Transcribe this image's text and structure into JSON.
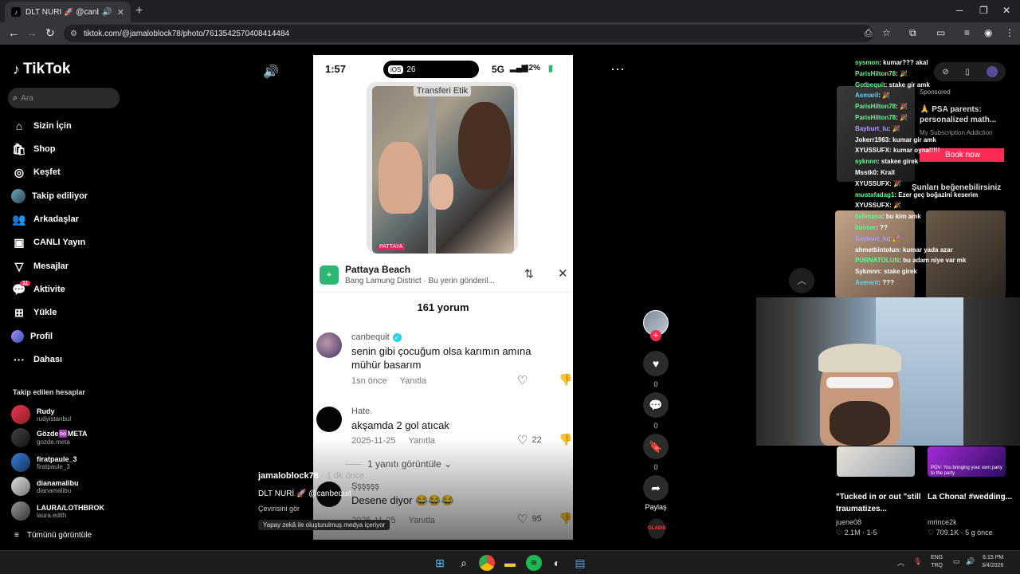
{
  "browser": {
    "tab_title": "DLT NURİ 🚀 @canbequit |",
    "new_tab": "+",
    "url": "tiktok.com/@jamaloblock78/photo/7613542570408414484"
  },
  "sidebar": {
    "logo": "TikTok",
    "search_placeholder": "Ara",
    "nav": [
      {
        "label": "Sizin İçin",
        "icon": "⌂"
      },
      {
        "label": "Shop",
        "icon": "🛍"
      },
      {
        "label": "Keşfet",
        "icon": "◎"
      },
      {
        "label": "Takip ediliyor",
        "icon": "●"
      },
      {
        "label": "Arkadaşlar",
        "icon": "👥"
      },
      {
        "label": "CANLI Yayın",
        "icon": "▣"
      },
      {
        "label": "Mesajlar",
        "icon": "▽"
      },
      {
        "label": "Aktivite",
        "icon": "💬",
        "badge": "11"
      },
      {
        "label": "Yükle",
        "icon": "⊞"
      },
      {
        "label": "Profil",
        "icon": "●"
      },
      {
        "label": "Dahası",
        "icon": "···"
      }
    ],
    "following_header": "Takip edilen hesaplar",
    "accounts": [
      {
        "name": "Rudy",
        "username": "rudyistanbul"
      },
      {
        "name": "Gözde♾️META",
        "username": "gozde.meta"
      },
      {
        "name": "firatpaule_3",
        "username": "firatpaule_3"
      },
      {
        "name": "dianamalibu",
        "username": "dianamalibu"
      },
      {
        "name": "LAURA/LOTHBROK",
        "username": "laura.edith"
      }
    ],
    "see_all": "Tümünü görüntüle"
  },
  "phone": {
    "time": "1:57",
    "ios_label": "iOS",
    "ios_version": "26",
    "network": "5G",
    "battery": "22%",
    "video_label": "Transferi Etik",
    "photo_tag": "PATTAYA",
    "location_name": "Pattaya Beach",
    "location_sub": "Bang Lamung District · Bu yerin gönderil...",
    "comment_count": "161 yorum",
    "comments": [
      {
        "user": "canbequit",
        "text": "senin gibi çocuğum olsa karımın amına mühür basarım",
        "time": "1sn önce",
        "reply": "Yanıtla",
        "likes": ""
      },
      {
        "user": "Hate.",
        "text": "akşamda 2 gol atıcak",
        "time": "2025-11-25",
        "reply": "Yanıtla",
        "likes": "22"
      },
      {
        "user": "Şşşşşş",
        "text": "Desene diyor 😂😂😂",
        "time": "2025-11-25",
        "reply": "Yanıtla",
        "likes": "95"
      }
    ],
    "view_replies": "1 yanıtı görüntüle ⌄"
  },
  "post": {
    "author": "jamaloblock78",
    "ago": " · 1 dk önce",
    "caption": "DLT NURİ 🚀 @canbequit",
    "translation": "Çevirisini gör",
    "ai_label": "Yapay zekâ ile oluşturulmuş medya içeriyor"
  },
  "actions": {
    "likes": "0",
    "comments": "0",
    "saves": "0",
    "share": "Paylaş",
    "music_label": "OLADIS"
  },
  "rightpanel": {
    "sponsored": "Sponsored",
    "ad_title": "🙏 PSA parents: personalized math...",
    "ad_sub": "My Subscription Addiction",
    "book_now": "Book now",
    "reco_title": "Şunları beğenebilirsiniz",
    "cards": [
      {
        "title": "\"Tucked in or out \"still traumatizes...",
        "user": "juene08",
        "views": "♡ 2.1M",
        "ago": "1-5"
      },
      {
        "title": "La Chona! #wedding...",
        "user": "mrince2k",
        "views": "♡ 709.1K",
        "ago": "5 g önce"
      }
    ],
    "card_overlay": "POV: You bringing your own party to the party"
  },
  "chat": [
    {
      "user": "sysmon",
      "msg": ": kumar??? akal",
      "cls": "u"
    },
    {
      "user": "ParisHilton78",
      "msg": ": 🎉",
      "cls": "u"
    },
    {
      "user": "Gotbequit",
      "msg": ": stake gir amk",
      "cls": "u"
    },
    {
      "user": "Asmaril",
      "msg": ": 🎉",
      "cls": "u2"
    },
    {
      "user": "ParisHilton78",
      "msg": ": 🎉",
      "cls": "u"
    },
    {
      "user": "ParisHilton78",
      "msg": ": 🎉",
      "cls": "u"
    },
    {
      "user": "Bayburt_lu",
      "msg": ": 🎉",
      "cls": "u3"
    },
    {
      "user": "Jokerr1963",
      "msg": ": kumar gir amk",
      "cls": "m"
    },
    {
      "user": "XYUSSUFX",
      "msg": ": kumar oyna!!!!!",
      "cls": "m"
    },
    {
      "user": "syknnn",
      "msg": ": stakee girek",
      "cls": "u"
    },
    {
      "user": "Msstk0",
      "msg": ": Krall",
      "cls": "m"
    },
    {
      "user": "XYUSSUFX",
      "msg": ": 🎉",
      "cls": "m"
    },
    {
      "user": "mustafadag1",
      "msg": ": Ezer geç boğazini keserim",
      "cls": "u"
    },
    {
      "user": "XYUSSUFX",
      "msg": ": 🎉",
      "cls": "m"
    },
    {
      "user": "6slimasa",
      "msg": ": bu kim amk",
      "cls": "u"
    },
    {
      "user": "ilooser",
      "msg": ": ??",
      "cls": "u"
    },
    {
      "user": "Bayburt_lu",
      "msg": ": 🎉",
      "cls": "u3"
    },
    {
      "user": "ahmetbintolun",
      "msg": ": kumar yada azar",
      "cls": "m"
    },
    {
      "user": "PURNATOLUN",
      "msg": ": bu adam niye var mk",
      "cls": "u"
    },
    {
      "user": "Sykmnn",
      "msg": ": stake girek",
      "cls": "m"
    },
    {
      "user": "Asmaril",
      "msg": ": ???",
      "cls": "u2"
    }
  ],
  "taskbar": {
    "lang_top": "ENG",
    "lang_bottom": "TRQ",
    "time": "6:15 PM",
    "date": "3/4/2026"
  }
}
